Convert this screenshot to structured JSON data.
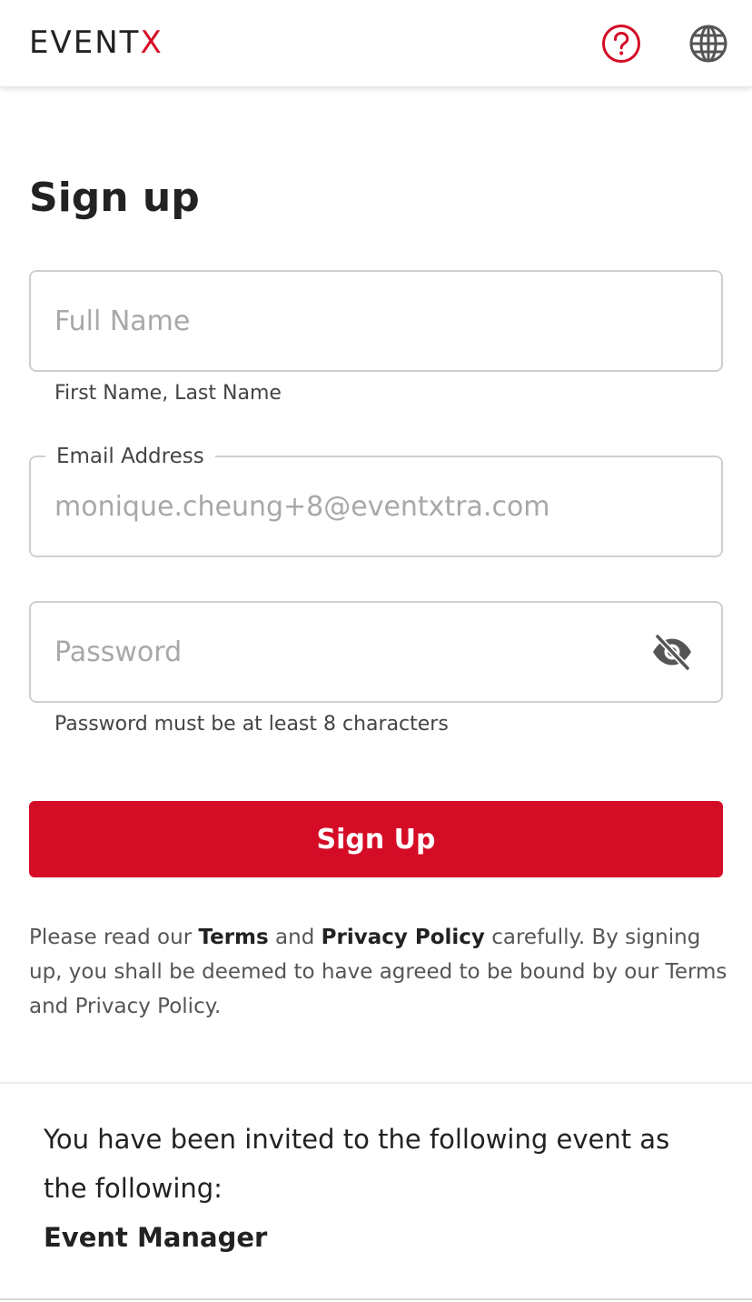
{
  "header": {
    "logo_main": "EVENT",
    "logo_x": "X",
    "icons": [
      "help-icon",
      "globe-icon"
    ]
  },
  "page": {
    "title": "Sign up"
  },
  "form": {
    "full_name": {
      "value": "",
      "placeholder": "Full Name",
      "helper": "First Name, Last Name"
    },
    "email": {
      "label": "Email Address",
      "value": "",
      "placeholder": "monique.cheung+8@eventxtra.com"
    },
    "password": {
      "value": "",
      "placeholder": "Password",
      "helper": "Password must be at least 8 characters",
      "toggle_icon": "eye-off-icon"
    },
    "submit_label": "Sign Up"
  },
  "terms": {
    "pre": "Please read our ",
    "terms_link": "Terms",
    "and": " and ",
    "privacy_link": "Privacy Policy",
    "post": " carefully. By signing up, you shall be deemed to have agreed to be bound by our Terms and Privacy Policy."
  },
  "invite": {
    "message": "You have been invited to the following event as the following:",
    "role": "Event Manager"
  },
  "colors": {
    "brand": "#d50c26",
    "text": "#222222",
    "muted": "#555555",
    "border": "#cfcfcf"
  }
}
